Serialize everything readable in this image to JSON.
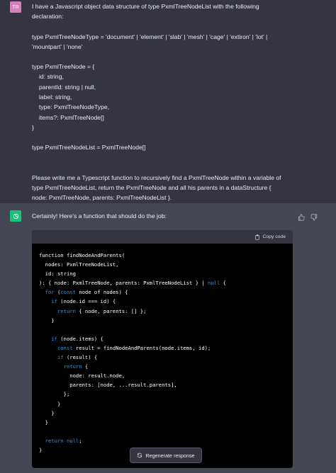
{
  "user": {
    "avatar_initials": "TR",
    "lines": {
      "l1": "I have a Javascript object data structure of type PxmlTreeNodeList with the following",
      "l2": "declaration:",
      "l3": "type PxmlTreeNodeType = 'document' | 'element' | 'slab' | 'mesh' | 'cage' | 'extiron' | 'lot' |",
      "l4": "'mountpart' | 'none'",
      "l5": "type PxmlTreeNode = {",
      "l6": "id: string,",
      "l7": "parentId: string | null,",
      "l8": "label: string,",
      "l9": "type: PxmlTreeNodeType,",
      "l10": "items?: PxmlTreeNode[]",
      "l11": "}",
      "l12": "type PxmlTreeNodeList = PxmlTreeNode[]",
      "l13": "Please write me a Typescript function to recursively find a PxmlTreeNode within a variable of",
      "l14": "type PxmlTreeNodeList, return the PxmlTreeNode and all his parents in a dataStructure {",
      "l15": "node: PxmlTreeNode, parents: PxmlTreeNodeList }."
    }
  },
  "assistant": {
    "intro": "Certainly! Here's a function that should do the job:",
    "copy_label": "Copy code",
    "regenerate_label": "Regenerate response",
    "code": {
      "c1": "function findNodeAndParents(",
      "c2": "  nodes: PxmlTreeNodeList,",
      "c3": "  id: string",
      "c4a": "): { node: PxmlTreeNode, parents: PxmlTreeNodeList } | ",
      "c4b": "null",
      "c4c": " {",
      "c5a": "  ",
      "c5b": "for",
      "c5c": " (",
      "c5d": "const",
      "c5e": " node of nodes) {",
      "c6a": "    ",
      "c6b": "if",
      "c6c": " (node.id === id) {",
      "c7a": "      ",
      "c7b": "return",
      "c7c": " { node, parents: [] };",
      "c8": "    }",
      "c9": "",
      "c10a": "    ",
      "c10b": "if",
      "c10c": " (node.items) {",
      "c11a": "      ",
      "c11b": "const",
      "c11c": " result = findNodeAndParents(node.items, id);",
      "c12a": "      ",
      "c12b": "if",
      "c12c": " (result) {",
      "c13a": "        ",
      "c13b": "return",
      "c13c": " {",
      "c14": "          node: result.node,",
      "c15": "          parents: [node, ...result.parents],",
      "c16": "        };",
      "c17": "      }",
      "c18": "    }",
      "c19": "  }",
      "c20": "",
      "c21a": "  ",
      "c21b": "return",
      "c21c": " ",
      "c21d": "null",
      "c21e": ";",
      "c22": "}"
    }
  },
  "colors": {
    "user_bg": "#343541",
    "assistant_bg": "#444654",
    "code_bg": "#000000",
    "keyword": "#2e95d3",
    "bot_avatar": "#19c37d",
    "user_avatar": "#d77fb9"
  },
  "icons": [
    "openai-logo-icon",
    "thumbs-up-icon",
    "thumbs-down-icon",
    "clipboard-icon",
    "refresh-icon"
  ]
}
